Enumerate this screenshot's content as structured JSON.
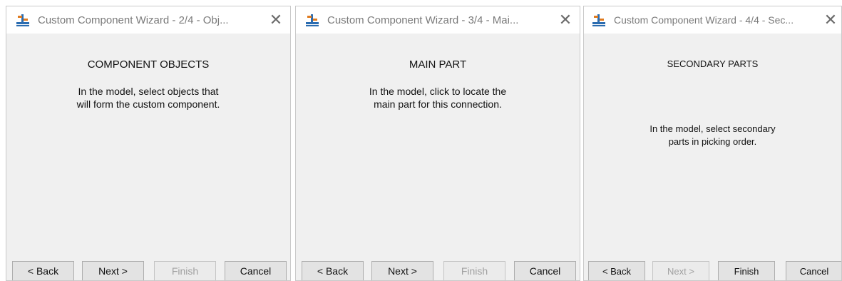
{
  "windows": [
    {
      "title": "Custom Component Wizard - 2/4 - Obj...",
      "heading": "COMPONENT OBJECTS",
      "instructions": [
        "In the model, select objects that",
        "will form the custom component."
      ],
      "buttons": {
        "back": "< Back",
        "next": "Next >",
        "finish": "Finish",
        "cancel": "Cancel"
      },
      "disabled": [
        "finish"
      ]
    },
    {
      "title": "Custom Component Wizard - 3/4 - Mai...",
      "heading": "MAIN PART",
      "instructions": [
        "In the model, click to locate the",
        "main part for this connection."
      ],
      "buttons": {
        "back": "< Back",
        "next": "Next >",
        "finish": "Finish",
        "cancel": "Cancel"
      },
      "disabled": [
        "finish"
      ]
    },
    {
      "title": "Custom Component Wizard - 4/4 - Sec...",
      "heading": "SECONDARY PARTS",
      "instructions": [
        "In the model, select secondary",
        "parts in picking order."
      ],
      "buttons": {
        "back": "< Back",
        "next": "Next >",
        "finish": "Finish",
        "cancel": "Cancel"
      },
      "disabled": [
        "next"
      ]
    }
  ],
  "close_glyph": "✕",
  "icon": "app-icon",
  "colors": {
    "icon_blue": "#2b6cb0",
    "icon_orange": "#e07b1f",
    "disabled_text": "#a0a0a0"
  }
}
